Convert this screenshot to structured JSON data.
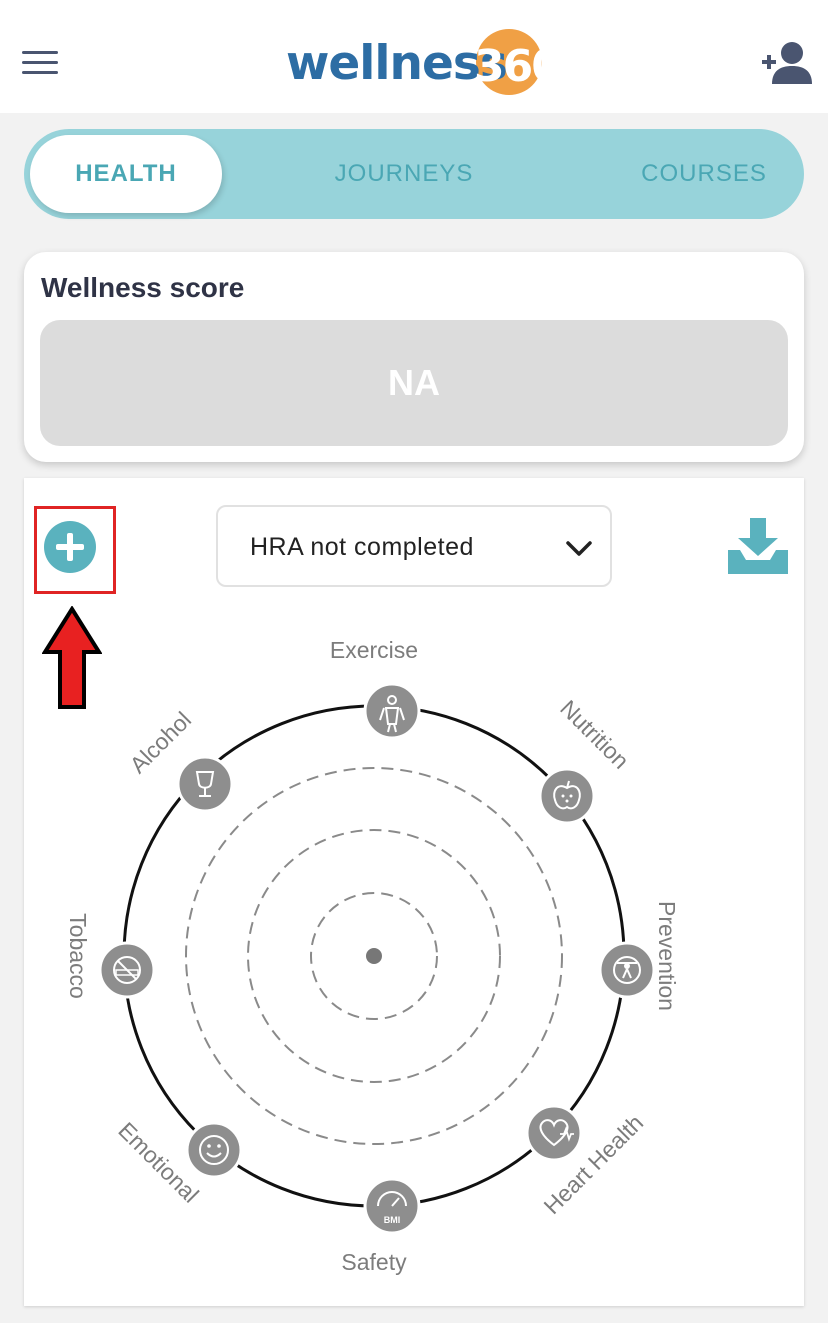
{
  "header": {
    "logo_text": "wellness",
    "logo_number": "360"
  },
  "tabs": [
    {
      "label": "HEALTH",
      "active": true
    },
    {
      "label": "JOURNEYS",
      "active": false
    },
    {
      "label": "COURSES",
      "active": false
    }
  ],
  "wellness_score": {
    "title": "Wellness score",
    "value": "NA"
  },
  "hra": {
    "dropdown_value": "HRA not completed"
  },
  "wheel": {
    "categories": {
      "exercise": "Exercise",
      "nutrition": "Nutrition",
      "prevention": "Prevention",
      "heart_health": "Heart Health",
      "safety": "Safety",
      "emotional": "Emotional",
      "tobacco": "Tobacco",
      "alcohol": "Alcohol"
    },
    "bmi_label": "BMI"
  },
  "colors": {
    "accent": "#5ab2be",
    "tab_bar": "#97d3da",
    "logo_blue": "#2d6da4",
    "logo_orange": "#f0a045",
    "highlight_red": "#e02424"
  }
}
